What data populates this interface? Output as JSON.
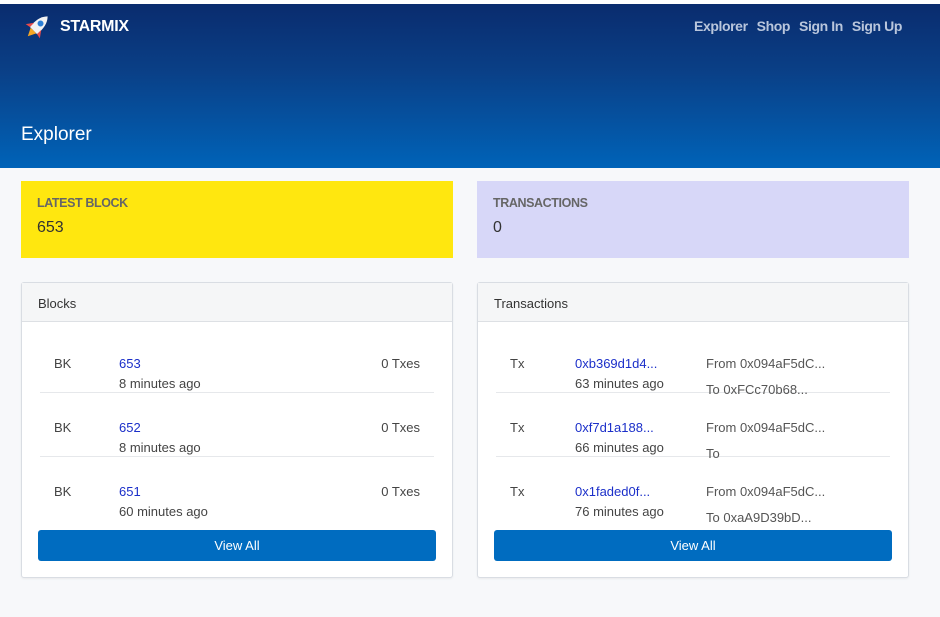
{
  "brand": {
    "name": "STARMIX",
    "logo_icon": "rocket-icon"
  },
  "nav": [
    "Explorer",
    "Shop",
    "Sign In",
    "Sign Up"
  ],
  "page_title": "Explorer",
  "stats": {
    "latest_block": {
      "label": "LATEST BLOCK",
      "value": "653",
      "color": "#ffe70f"
    },
    "transactions": {
      "label": "TRANSACTIONS",
      "value": "0",
      "color": "#d7d7f8"
    }
  },
  "blocks_panel": {
    "title": "Blocks",
    "rows": [
      {
        "tag": "BK",
        "number": "653",
        "age": "8 minutes ago",
        "txes": "0 Txes"
      },
      {
        "tag": "BK",
        "number": "652",
        "age": "8 minutes ago",
        "txes": "0 Txes"
      },
      {
        "tag": "BK",
        "number": "651",
        "age": "60 minutes ago",
        "txes": "0 Txes"
      }
    ],
    "button": "View All"
  },
  "transactions_panel": {
    "title": "Transactions",
    "rows": [
      {
        "tag": "Tx",
        "hash": "0xb369d1d4...",
        "age": "63 minutes ago",
        "from": "From 0x094aF5dC...",
        "to": "To 0xFCc70b68..."
      },
      {
        "tag": "Tx",
        "hash": "0xf7d1a188...",
        "age": "66 minutes ago",
        "from": "From 0x094aF5dC...",
        "to": "To"
      },
      {
        "tag": "Tx",
        "hash": "0x1faded0f...",
        "age": "76 minutes ago",
        "from": "From 0x094aF5dC...",
        "to": "To 0xaA9D39bD..."
      }
    ],
    "button": "View All"
  },
  "colors": {
    "header_dark": "#0a2c6e",
    "header_light": "#0063b8",
    "accent": "#006cc0",
    "link": "#1b2fc9"
  }
}
